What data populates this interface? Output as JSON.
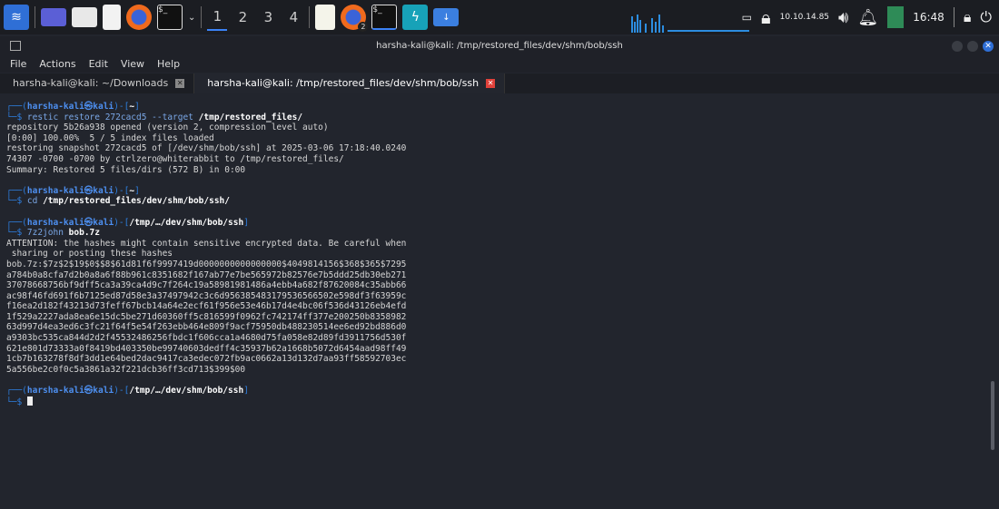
{
  "taskbar": {
    "workspaces": [
      "1",
      "2",
      "3",
      "4"
    ],
    "active_workspace": "1",
    "firefox_badge": "2",
    "tray": {
      "ip": "10.10.14.85",
      "time": "16:48"
    }
  },
  "window": {
    "title": "harsha-kali@kali: /tmp/restored_files/dev/shm/bob/ssh"
  },
  "menu": [
    "File",
    "Actions",
    "Edit",
    "View",
    "Help"
  ],
  "tabs": [
    {
      "label": "harsha-kali@kali: ~/Downloads",
      "active": false
    },
    {
      "label": "harsha-kali@kali: /tmp/restored_files/dev/shm/bob/ssh",
      "active": true
    }
  ],
  "terminal": {
    "user": "harsha-kali㉿kali",
    "blocks": [
      {
        "cwd": "~",
        "cmd": "restic",
        "args": " restore 272cacd5 --target ",
        "bold": "/tmp/restored_files/",
        "output": [
          "repository 5b26a938 opened (version 2, compression level auto)",
          "[0:00] 100.00%  5 / 5 index files loaded",
          "restoring snapshot 272cacd5 of [/dev/shm/bob/ssh] at 2025-03-06 17:18:40.0240",
          "74307 -0700 -0700 by ctrlzero@whiterabbit to /tmp/restored_files/",
          "Summary: Restored 5 files/dirs (572 B) in 0:00",
          ""
        ]
      },
      {
        "cwd": "~",
        "cmd": "cd",
        "args": " ",
        "bold": "/tmp/restored_files/dev/shm/bob/ssh/",
        "output": [
          ""
        ]
      },
      {
        "cwd": "/tmp/…/dev/shm/bob/ssh",
        "cmd": "7z2john",
        "args": " ",
        "bold": "bob.7z",
        "output": [
          "ATTENTION: the hashes might contain sensitive encrypted data. Be careful when",
          " sharing or posting these hashes",
          "bob.7z:$7z$2$19$0$$8$61d81f6f9997419d0000000000000000$4049814156$368$365$7295",
          "a784b0a8cfa7d2b0a8a6f88b961c8351682f167ab77e7be565972b82576e7b5ddd25db30eb271",
          "37078668756bf9dff5ca3a39ca4d9c7f264c19a58981981486a4ebb4a682f87620084c35abb66",
          "ac98f46fd691f6b7125ed87d58e3a37497942c3c6d956385483179536566502e598df3f63959c",
          "f16ea2d182f43213d73feff67bcb14a64e2ecf61f956e53e46b17d4e4bc06f536d43126eb4efd",
          "1f529a2227ada8ea6e15dc5be271d60360ff5c816599f0962fc742174ff377e200250b8358982",
          "63d997d4ea3ed6c3fc21f64f5e54f263ebb464e809f9acf75950db488230514ee6ed92bd886d0",
          "a9303bc535ca844d2d2f45532486256fbdc1f606cca1a4680d75fa058e82d89fd3911756d530f",
          "621e801d73333a0f8419bd403350be99740603dedff4c35937b62a1668b5072d6454aad98ff49",
          "1cb7b163278f8df3dd1e64bed2dac9417ca3edec072fb9ac0662a13d132d7aa93ff58592703ec",
          "5a556be2c0f0c5a3861a32f221dcb36ff3cd713$399$00",
          ""
        ]
      }
    ],
    "final_cwd": "/tmp/…/dev/shm/bob/ssh"
  }
}
